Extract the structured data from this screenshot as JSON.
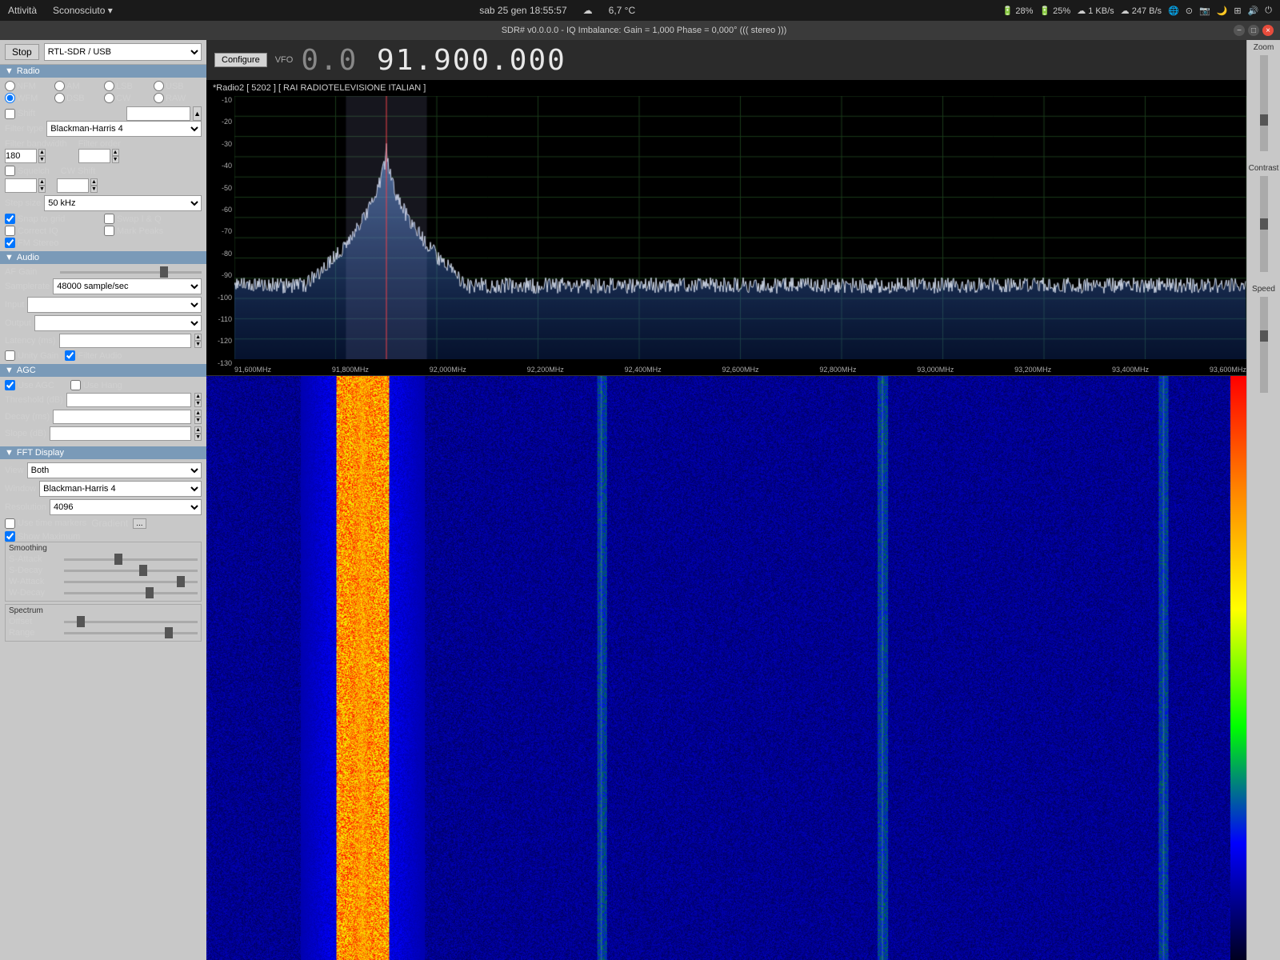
{
  "topbar": {
    "left": {
      "activities": "Attività",
      "unknown": "Sconosciuto",
      "arrow": "▾"
    },
    "center": {
      "datetime": "sab 25 gen  18:55:57",
      "cloud_icon": "☁",
      "temperature": "6,7 °C"
    },
    "right": {
      "battery1": "28%",
      "battery2": "25%",
      "upload": "1 KB/s",
      "download": "247 B/s",
      "icons": [
        "☁",
        "☁",
        "📷",
        "🌙",
        "⊞",
        "🔊",
        "⏻"
      ]
    }
  },
  "titlebar": {
    "title": "SDR# v0.0.0.0 - IQ Imbalance: Gain = 1,000 Phase = 0,000° ((( stereo )))",
    "min": "−",
    "max": "□",
    "close": "×"
  },
  "toolbar": {
    "stop_label": "Stop",
    "device": "RTL-SDR / USB"
  },
  "vfo": {
    "configure_label": "Configure",
    "label": "VFO",
    "frequency_dim": "0.0",
    "frequency_bright": "91.900.000"
  },
  "radio": {
    "section_label": "Radio",
    "modes": [
      {
        "label": "NFM",
        "checked": true,
        "name": "mode",
        "value": "NFM"
      },
      {
        "label": "AM",
        "checked": false,
        "name": "mode",
        "value": "AM"
      },
      {
        "label": "LSB",
        "checked": false,
        "name": "mode",
        "value": "LSB"
      },
      {
        "label": "USB",
        "checked": false,
        "name": "mode",
        "value": "USB"
      },
      {
        "label": "WFM",
        "checked": true,
        "name": "mode",
        "value": "WFM"
      },
      {
        "label": "DSB",
        "checked": false,
        "name": "mode",
        "value": "DSB"
      },
      {
        "label": "CW",
        "checked": false,
        "name": "mode",
        "value": "CW"
      },
      {
        "label": "RAW",
        "checked": false,
        "name": "mode",
        "value": "RAW"
      }
    ],
    "shift_label": "Shift",
    "filter_type_label": "Filter type",
    "filter_type_value": "Blackman-Harris 4",
    "filter_bandwidth_label": "Filter bandwidth",
    "filter_bandwidth_value": "180",
    "filter_order_label": "Filter order",
    "squelch_label": "Squelch",
    "cw_shift_label": "CW Shift",
    "step_size_label": "Step size",
    "step_size_value": "50 kHz",
    "snap_to_grid_label": "Snap to grid",
    "snap_to_grid_checked": true,
    "correct_iq_label": "Correct IQ",
    "correct_iq_checked": false,
    "swap_iq_label": "Swap I & Q",
    "swap_iq_checked": false,
    "fm_stereo_label": "FM Stereo",
    "fm_stereo_checked": true,
    "mark_peaks_label": "Mark Peaks",
    "mark_peaks_checked": false
  },
  "audio": {
    "section_label": "Audio",
    "af_gain_label": "AF Gain",
    "samplerate_label": "Samplerate",
    "samplerate_value": "48000 sample/sec",
    "input_label": "Input",
    "input_value": "",
    "output_label": "Output",
    "output_value": "",
    "latency_label": "Latency (ms)",
    "unity_gain_label": "Unity Gain",
    "unity_gain_checked": false,
    "filter_audio_label": "Filter Audio",
    "filter_audio_checked": true
  },
  "agc": {
    "section_label": "AGC",
    "use_agc_label": "Use AGC",
    "use_agc_checked": true,
    "use_hang_label": "Use Hang",
    "use_hang_checked": false,
    "threshold_label": "Threshold (dB)",
    "decay_label": "Decay (ms)",
    "slope_label": "Slope (dB)"
  },
  "fft_display": {
    "section_label": "FFT Display",
    "view_label": "View",
    "view_value": "Both",
    "window_label": "Window",
    "window_value": "Blackman-Harris 4",
    "resolution_label": "Resolution",
    "resolution_value": "4096",
    "use_time_markers_label": "Use time markers",
    "use_time_markers_checked": false,
    "gradient_label": "Gradient",
    "gradient_btn": "...",
    "show_maximum_label": "Show Maximum",
    "show_maximum_checked": true
  },
  "smoothing": {
    "title": "Smoothing",
    "s_attack_label": "S-Attack",
    "s_decay_label": "S-Decay",
    "w_attack_label": "W-Attack",
    "w_decay_label": "W-Decay"
  },
  "spectrum_ctrl": {
    "title": "Spectrum",
    "offset_label": "Offset",
    "range_label": "Range"
  },
  "spectrum": {
    "station_label": "*Radio2  [ 5202 ]  [ RAI RADIOTELEVISIONE ITALIAN ]",
    "y_labels": [
      "-10",
      "-20",
      "-30",
      "-40",
      "-50",
      "-60",
      "-70",
      "-80",
      "-90",
      "-100",
      "-110",
      "-120",
      "-130"
    ],
    "x_labels": [
      "91,600MHz",
      "91,800MHz",
      "92,000MHz",
      "92,200MHz",
      "92,400MHz",
      "92,600MHz",
      "92,800MHz",
      "93,000MHz",
      "93,200MHz",
      "93,400MHz",
      "93,600MHz"
    ]
  },
  "right_controls": {
    "zoom_label": "Zoom",
    "contrast_label": "Contrast",
    "speed_label": "Speed"
  }
}
